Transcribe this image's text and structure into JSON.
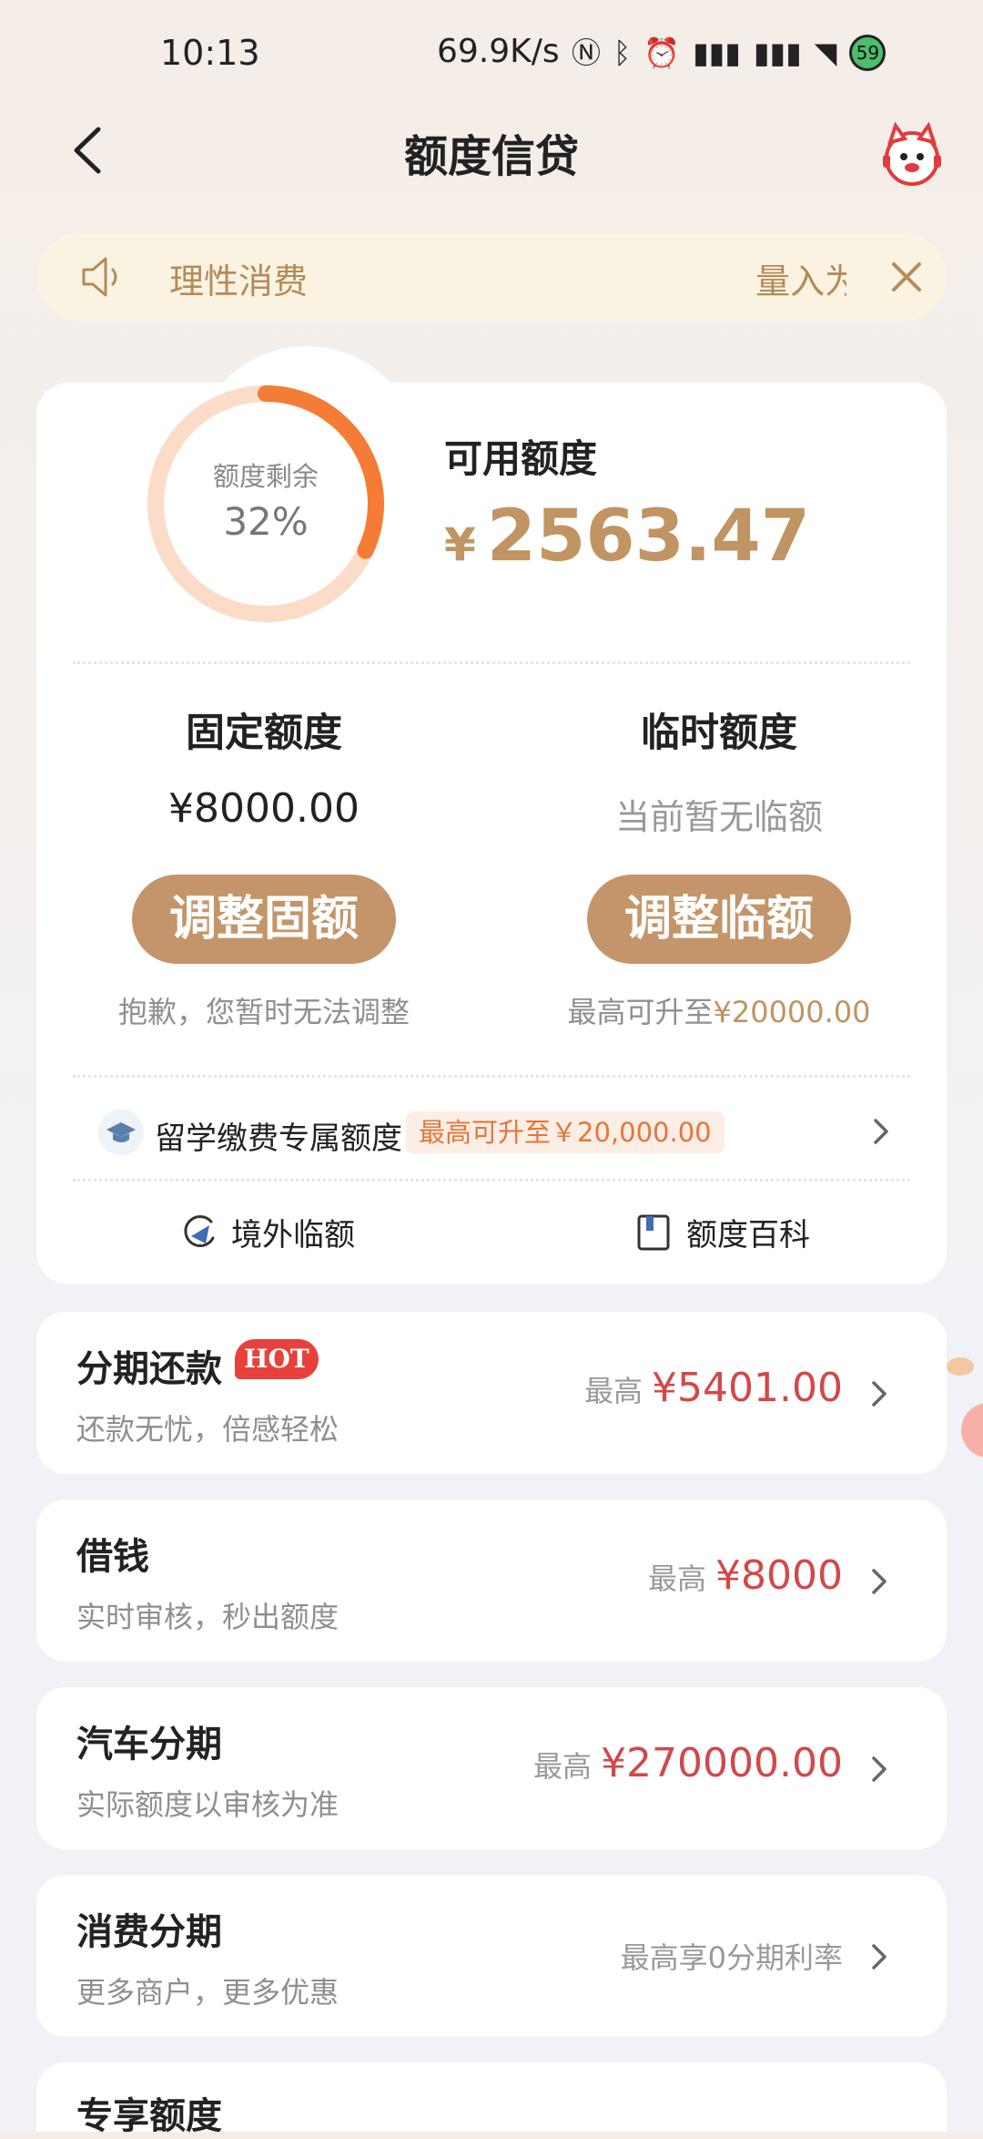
{
  "status_bar": {
    "time": "10:13",
    "speed": "69.9K/s",
    "battery": "59",
    "icons": [
      "nfc-icon",
      "bluetooth-icon",
      "alarm-icon",
      "signal-icon",
      "signal-icon",
      "wifi-icon"
    ]
  },
  "header": {
    "title": "额度信贷"
  },
  "notice": {
    "text_left": "理性消费",
    "text_right": "量入为"
  },
  "credit": {
    "ring_label": "额度剩余",
    "ring_percent": "32%",
    "ring_fraction": 0.32,
    "available_label": "可用额度",
    "currency": "¥",
    "available_amount": "2563.47"
  },
  "fixed": {
    "title": "固定额度",
    "value": "¥8000.00",
    "button": "调整固额",
    "note": "抱歉，您暂时无法调整"
  },
  "temp": {
    "title": "临时额度",
    "value": "当前暂无临额",
    "button": "调整临额",
    "note_prefix": "最高可升至",
    "note_amount": "¥20000.00"
  },
  "study": {
    "label": "留学缴费专属额度",
    "tag": "最高可升至￥20,000.00"
  },
  "links": {
    "overseas": "境外临额",
    "wiki": "额度百科"
  },
  "list": [
    {
      "title": "分期还款",
      "badge": "HOT",
      "sub": "还款无忧，倍感轻松",
      "prefix": "最高",
      "amount": "¥5401.00"
    },
    {
      "title": "借钱",
      "sub": "实时审核，秒出额度",
      "prefix": "最高",
      "amount": "¥8000"
    },
    {
      "title": "汽车分期",
      "sub": "实际额度以审核为准",
      "prefix": "最高",
      "amount": "¥270000.00"
    },
    {
      "title": "消费分期",
      "sub": "更多商户，更多优惠",
      "prefix": "最高享0分期利率",
      "amount": ""
    },
    {
      "title": "专享额度"
    }
  ],
  "colors": {
    "accent_gold": "#c4956a",
    "ring_orange": "#f57c35",
    "ring_track": "#fbdcc8",
    "amount_red": "#d1484b"
  }
}
